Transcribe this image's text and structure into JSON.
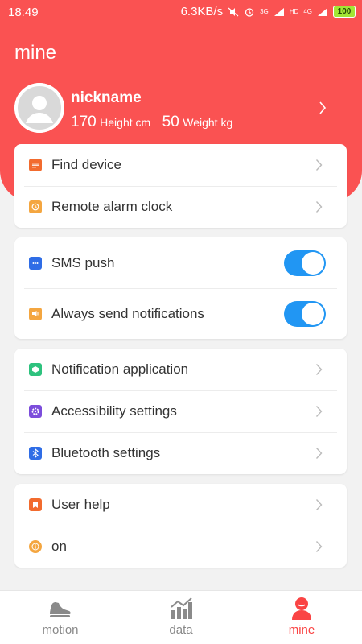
{
  "status_bar": {
    "time": "18:49",
    "network_speed": "6.3KB/s",
    "signal_3g": "3G",
    "signal_4g": "4G",
    "hd": "HD",
    "battery": "100"
  },
  "header": {
    "title": "mine",
    "accent_color": "#fa5252"
  },
  "profile": {
    "nickname": "nickname",
    "height_value": "170",
    "height_unit": "Height cm",
    "weight_value": "50",
    "weight_unit": "Weight kg"
  },
  "cards": [
    {
      "rows": [
        {
          "label": "Find device",
          "icon": "find-device-icon",
          "color": "#f26b2e"
        },
        {
          "label": "Remote alarm clock",
          "icon": "alarm-clock-icon",
          "color": "#f4a640"
        }
      ]
    },
    {
      "rows": [
        {
          "label": "SMS push",
          "icon": "sms-icon",
          "color": "#2f6de6",
          "toggle": true
        },
        {
          "label": "Always send notifications",
          "icon": "notification-icon",
          "color": "#f4a640",
          "toggle": true
        }
      ]
    },
    {
      "rows": [
        {
          "label": "Notification application",
          "icon": "notification-app-icon",
          "color": "#2ec27e"
        },
        {
          "label": "Accessibility settings",
          "icon": "accessibility-icon",
          "color": "#7c4ddb"
        },
        {
          "label": "Bluetooth settings",
          "icon": "bluetooth-icon",
          "color": "#2f6de6"
        }
      ]
    },
    {
      "rows": [
        {
          "label": "User help",
          "icon": "user-help-icon",
          "color": "#f26b2e"
        },
        {
          "label": "on",
          "icon": "info-icon",
          "color": "#f4a640"
        }
      ]
    }
  ],
  "bottom_nav": {
    "items": [
      {
        "label": "motion",
        "icon": "shoe-icon"
      },
      {
        "label": "data",
        "icon": "chart-icon"
      },
      {
        "label": "mine",
        "icon": "person-icon",
        "active": true
      }
    ]
  }
}
